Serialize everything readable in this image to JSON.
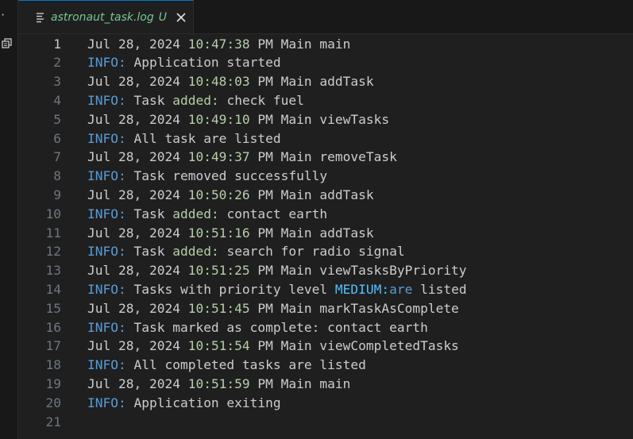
{
  "tab": {
    "title": "astronaut_task.log",
    "status": "U"
  },
  "icons": {
    "file": "file-lines-icon",
    "close": "close-icon",
    "copy": "copy-icon"
  },
  "colors": {
    "background": "#1f1f1f",
    "line_number": "#6e7681",
    "text": "#cccccc",
    "info": "#569cd6",
    "time": "#b5cea8",
    "untracked": "#73c991"
  },
  "lines": [
    {
      "n": "1",
      "date": "Jul 28, 2024 ",
      "time": "10:47:38",
      "rest": " PM Main main"
    },
    {
      "n": "2",
      "info": "INFO:",
      "text": " Application started"
    },
    {
      "n": "3",
      "date": "Jul 28, 2024 ",
      "time": "10:48:03",
      "rest": " PM Main addTask"
    },
    {
      "n": "4",
      "info": "INFO:",
      "pre": " Task ",
      "added": "added:",
      "text": " check fuel"
    },
    {
      "n": "5",
      "date": "Jul 28, 2024 ",
      "time": "10:49:10",
      "rest": " PM Main viewTasks"
    },
    {
      "n": "6",
      "info": "INFO:",
      "text": " All task are listed"
    },
    {
      "n": "7",
      "date": "Jul 28, 2024 ",
      "time": "10:49:37",
      "rest": " PM Main removeTask"
    },
    {
      "n": "8",
      "info": "INFO:",
      "text": " Task removed successfully"
    },
    {
      "n": "9",
      "date": "Jul 28, 2024 ",
      "time": "10:50:26",
      "rest": " PM Main addTask"
    },
    {
      "n": "10",
      "info": "INFO:",
      "pre": " Task ",
      "added": "added:",
      "text": " contact earth"
    },
    {
      "n": "11",
      "date": "Jul 28, 2024 ",
      "time": "10:51:16",
      "rest": " PM Main addTask"
    },
    {
      "n": "12",
      "info": "INFO:",
      "pre": " Task ",
      "added": "added:",
      "text": " search for radio signal"
    },
    {
      "n": "13",
      "date": "Jul 28, 2024 ",
      "time": "10:51:25",
      "rest": " PM Main viewTasksByPriority"
    },
    {
      "n": "14",
      "info": "INFO:",
      "pre": " Tasks with priority level ",
      "kw": "MEDIUM:",
      "kw2": "are",
      "text": " listed"
    },
    {
      "n": "15",
      "date": "Jul 28, 2024 ",
      "time": "10:51:45",
      "rest": " PM Main markTaskAsComplete"
    },
    {
      "n": "16",
      "info": "INFO:",
      "text": " Task marked as complete: contact earth"
    },
    {
      "n": "17",
      "date": "Jul 28, 2024 ",
      "time": "10:51:54",
      "rest": " PM Main viewCompletedTasks"
    },
    {
      "n": "18",
      "info": "INFO:",
      "text": " All completed tasks are listed"
    },
    {
      "n": "19",
      "date": "Jul 28, 2024 ",
      "time": "10:51:59",
      "rest": " PM Main main"
    },
    {
      "n": "20",
      "info": "INFO:",
      "text": " Application exiting"
    },
    {
      "n": "21"
    }
  ]
}
